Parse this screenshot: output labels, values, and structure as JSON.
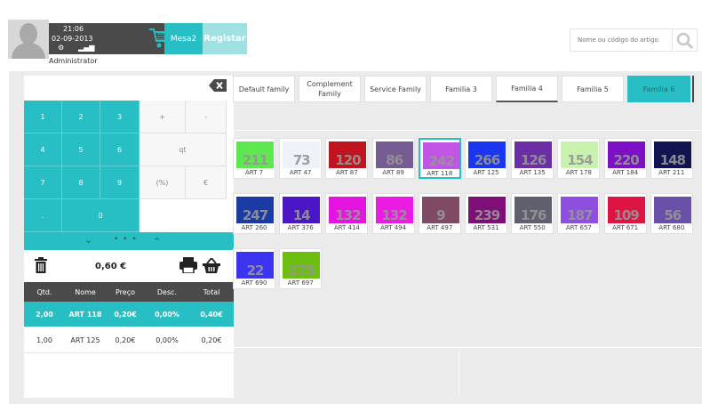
{
  "header": {
    "time": "21:06",
    "date": "02-09-2013",
    "user": "Administrator",
    "table_button": "Mesa2",
    "register_button": "Registar",
    "search_placeholder": "Nome ou código do artigo"
  },
  "keypad": {
    "keys": [
      "1",
      "2",
      "3",
      "+",
      "-",
      "4",
      "5",
      "6",
      "qt",
      "7",
      "8",
      "9",
      "(%)",
      "€",
      ".",
      "0"
    ],
    "dots": "• • •"
  },
  "order": {
    "total": "0,60 €",
    "columns": [
      "Qtd.",
      "Nome",
      "Preço",
      "Desc.",
      "Total"
    ],
    "rows": [
      {
        "qty": "2,00",
        "name": "ART 118",
        "price": "0,20€",
        "discount": "0,00%",
        "total": "0,40€"
      },
      {
        "qty": "1,00",
        "name": "ART 125",
        "price": "0,20€",
        "discount": "0,00%",
        "total": "0,20€"
      }
    ]
  },
  "families": [
    {
      "label": "Default family"
    },
    {
      "label": "Complement Family"
    },
    {
      "label": "Service Family"
    },
    {
      "label": "Familia 3"
    },
    {
      "label": "Familia 4"
    },
    {
      "label": "Familia 5"
    },
    {
      "label": "Familia 6"
    }
  ],
  "articles": [
    {
      "num": "211",
      "label": "ART 7",
      "color": "#5ee84f"
    },
    {
      "num": "73",
      "label": "ART 47",
      "color": "#eef2f9"
    },
    {
      "num": "120",
      "label": "ART 87",
      "color": "#c0141f"
    },
    {
      "num": "86",
      "label": "ART 89",
      "color": "#755c92"
    },
    {
      "num": "242",
      "label": "ART 118",
      "color": "#c056e2"
    },
    {
      "num": "266",
      "label": "ART 125",
      "color": "#1a36ef"
    },
    {
      "num": "126",
      "label": "ART 135",
      "color": "#6c2ea4"
    },
    {
      "num": "154",
      "label": "ART 178",
      "color": "#c8f2ad"
    },
    {
      "num": "220",
      "label": "ART 184",
      "color": "#7d0fc4"
    },
    {
      "num": "148",
      "label": "ART 211",
      "color": "#111450"
    },
    {
      "num": "247",
      "label": "ART 260",
      "color": "#1a3aa6"
    },
    {
      "num": "14",
      "label": "ART 376",
      "color": "#4a16c6"
    },
    {
      "num": "132",
      "label": "ART 414",
      "color": "#e514e0"
    },
    {
      "num": "132",
      "label": "ART 494",
      "color": "#ea1ce4"
    },
    {
      "num": "9",
      "label": "ART 497",
      "color": "#7f4a63"
    },
    {
      "num": "239",
      "label": "ART 531",
      "color": "#7e0f76"
    },
    {
      "num": "176",
      "label": "ART 550",
      "color": "#605f6e"
    },
    {
      "num": "187",
      "label": "ART 657",
      "color": "#8e4ee0"
    },
    {
      "num": "109",
      "label": "ART 671",
      "color": "#de1443"
    },
    {
      "num": "56",
      "label": "ART 680",
      "color": "#6b50aa"
    },
    {
      "num": "22",
      "label": "ART 690",
      "color": "#3c34f0"
    },
    {
      "num": "275",
      "label": "ART 697",
      "color": "#6cbf10"
    }
  ],
  "colors": {
    "accent": "#28bfc4",
    "dark": "#4a4a4a",
    "background": "#ebebeb"
  }
}
